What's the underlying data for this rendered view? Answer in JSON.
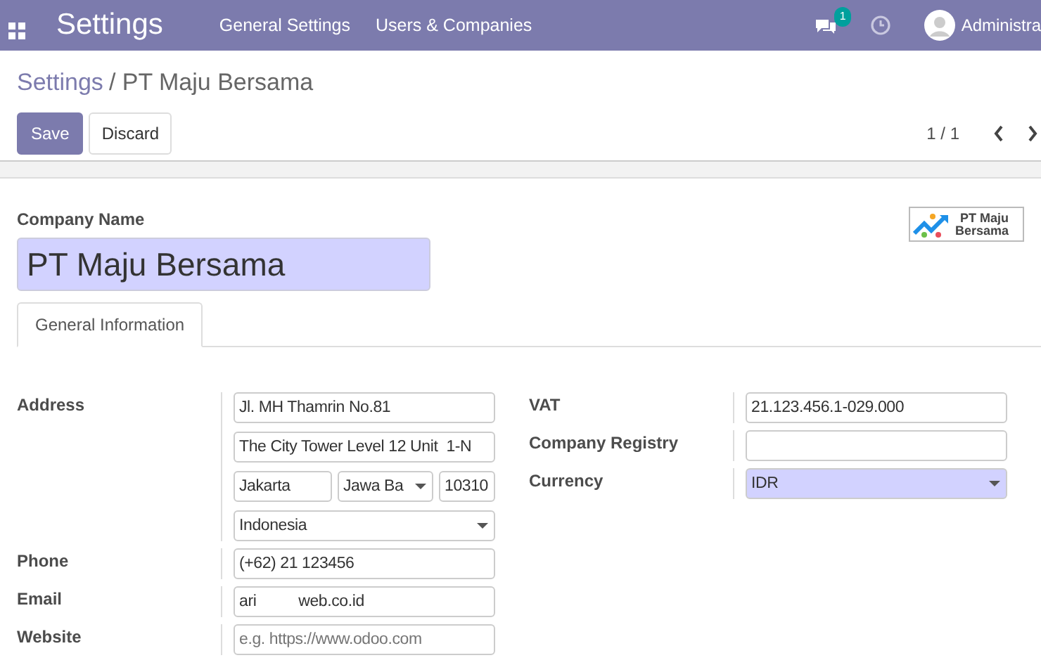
{
  "navbar": {
    "app_title": "Settings",
    "menu": [
      {
        "label": "General Settings"
      },
      {
        "label": "Users & Companies"
      }
    ],
    "message_count": "1",
    "user": "Administra"
  },
  "breadcrumb": [
    {
      "label": "Settings",
      "kind": "link"
    },
    {
      "label": "/ PT Maju Bersama",
      "kind": "current"
    }
  ],
  "buttons": [
    {
      "label": "Save",
      "kind": "primary"
    },
    {
      "label": "Discard",
      "kind": "secondary"
    }
  ],
  "pager": "1 / 1",
  "company_name": {
    "label": "Company Name",
    "value": "PT Maju Bersama"
  },
  "logo": {
    "text": [
      "PT Maju",
      "Bersama"
    ]
  },
  "tabs": [
    {
      "label": "General Information",
      "selected": true
    }
  ],
  "left_fields": [
    {
      "label": "Address",
      "rows": [
        [
          {
            "value": "Jl. MH Thamrin No.81",
            "kind": "text"
          }
        ],
        [
          {
            "value": "The City Tower Level 12 Unit  1-N",
            "kind": "text"
          }
        ],
        [
          {
            "value": "Jakarta",
            "kind": "text"
          },
          {
            "value": "Jawa Ba",
            "kind": "select"
          },
          {
            "value": "10310",
            "kind": "text"
          }
        ],
        [
          {
            "value": "Indonesia",
            "kind": "select"
          }
        ]
      ]
    },
    {
      "label": "Phone",
      "rows": [
        [
          {
            "value": "(+62) 21 123456",
            "kind": "text"
          }
        ]
      ]
    },
    {
      "label": "Email",
      "rows": [
        [
          {
            "value": "ari          web.co.id",
            "kind": "text"
          }
        ]
      ]
    },
    {
      "label": "Website",
      "rows": [
        [
          {
            "placeholder": "e.g. https://www.odoo.com",
            "kind": "text"
          }
        ]
      ]
    }
  ],
  "right_fields": [
    {
      "label": "VAT",
      "rows": [
        [
          {
            "value": "21.123.456.1-029.000",
            "kind": "text"
          }
        ]
      ]
    },
    {
      "label": "Company Registry",
      "rows": [
        [
          {
            "kind": "text"
          }
        ]
      ]
    },
    {
      "label": "Currency",
      "rows": [
        [
          {
            "value": "IDR",
            "kind": "select",
            "required": true
          }
        ]
      ]
    }
  ]
}
